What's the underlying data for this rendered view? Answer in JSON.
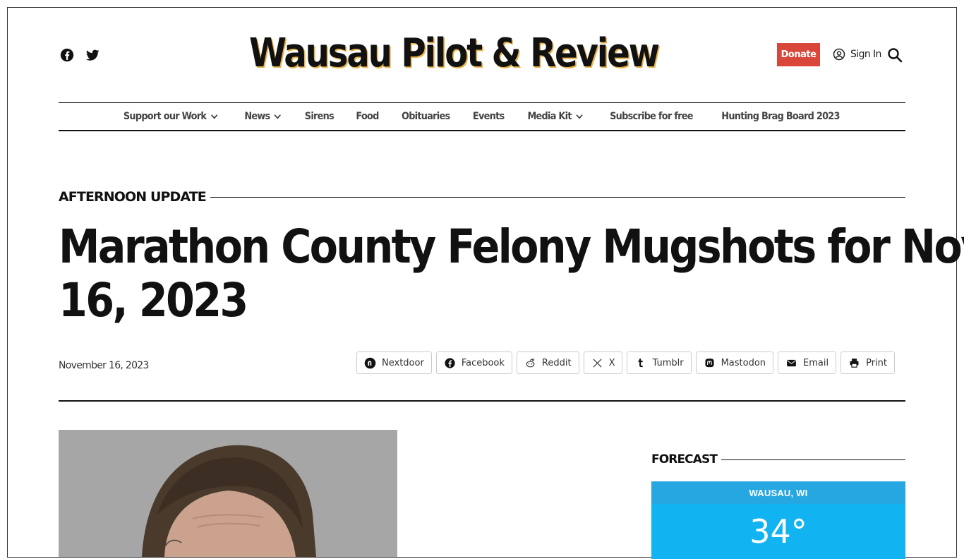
{
  "site": {
    "title": "Wausau Pilot & Review",
    "donate_label": "Donate",
    "signin_label": "Sign In"
  },
  "nav": {
    "items": [
      {
        "label": "Support our Work",
        "dropdown": true
      },
      {
        "label": "News",
        "dropdown": true
      },
      {
        "label": "Sirens",
        "dropdown": false
      },
      {
        "label": "Food",
        "dropdown": false
      },
      {
        "label": "Obituaries",
        "dropdown": false
      },
      {
        "label": "Events",
        "dropdown": false
      },
      {
        "label": "Media Kit",
        "dropdown": true
      },
      {
        "label": "Subscribe for free",
        "dropdown": false
      },
      {
        "label": "Hunting Brag Board 2023",
        "dropdown": false
      }
    ]
  },
  "article": {
    "kicker": "AFTERNOON UPDATE",
    "headline_line1": "Marathon County Felony Mugshots for Nov.",
    "headline_line2": "16, 2023",
    "date": "November 16, 2023"
  },
  "share": {
    "buttons": [
      {
        "label": "Nextdoor",
        "icon": "nextdoor-icon"
      },
      {
        "label": "Facebook",
        "icon": "facebook-icon"
      },
      {
        "label": "Reddit",
        "icon": "reddit-icon"
      },
      {
        "label": "X",
        "icon": "x-icon"
      },
      {
        "label": "Tumblr",
        "icon": "tumblr-icon"
      },
      {
        "label": "Mastodon",
        "icon": "mastodon-icon"
      },
      {
        "label": "Email",
        "icon": "email-icon"
      },
      {
        "label": "Print",
        "icon": "print-icon"
      }
    ]
  },
  "sidebar": {
    "forecast_title": "FORECAST",
    "weather": {
      "location": "WAUSAU, WI",
      "temperature": "34°"
    }
  },
  "colors": {
    "donate": "#d9473b",
    "brand_shadow": "#e8b24a",
    "weather_bg": "#11b4f0"
  }
}
